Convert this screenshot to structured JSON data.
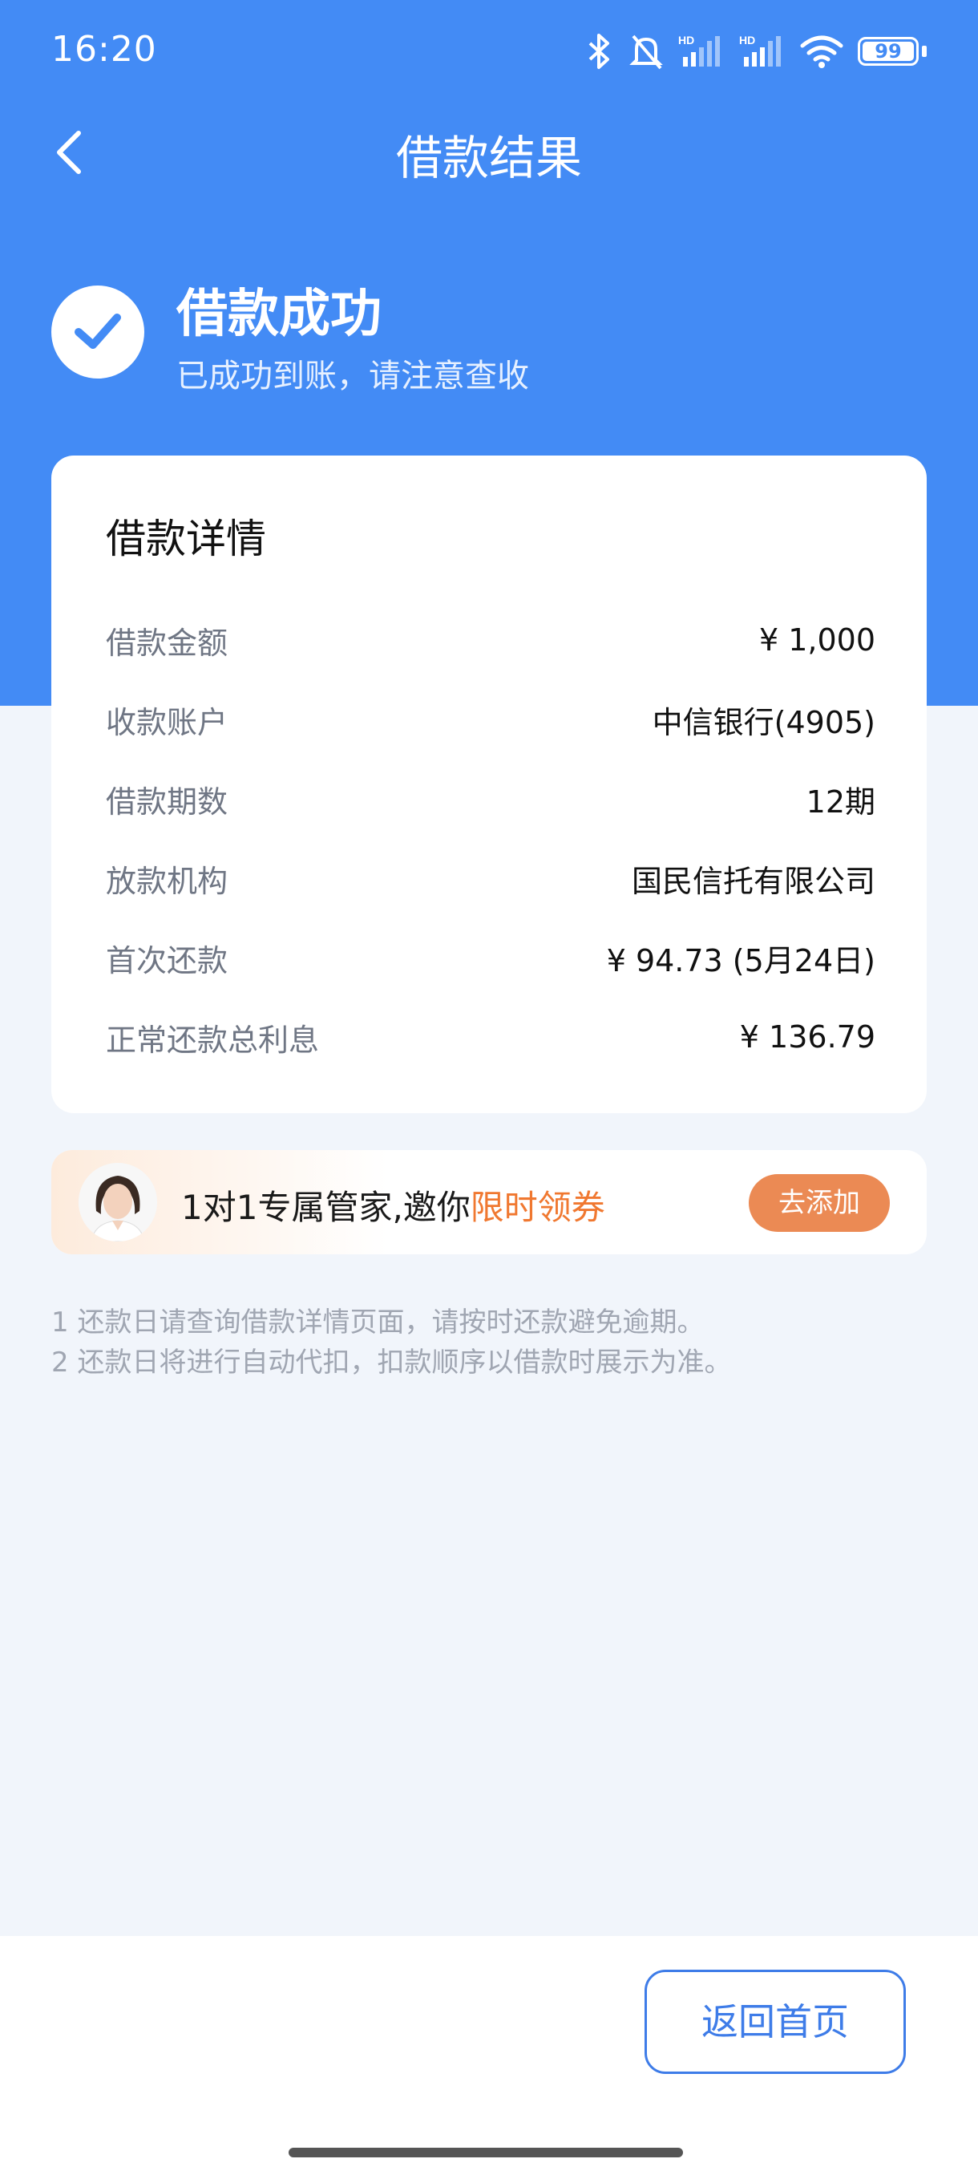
{
  "status_bar": {
    "time": "16:20",
    "battery": "99"
  },
  "header": {
    "title": "借款结果"
  },
  "result": {
    "title": "借款成功",
    "subtitle": "已成功到账，请注意查收"
  },
  "details": {
    "title": "借款详情",
    "rows": [
      {
        "label": "借款金额",
        "value": "¥ 1,000"
      },
      {
        "label": "收款账户",
        "value": "中信银行(4905)"
      },
      {
        "label": "借款期数",
        "value": "12期"
      },
      {
        "label": "放款机构",
        "value": "国民信托有限公司"
      },
      {
        "label": "首次还款",
        "value": "¥ 94.73 (5月24日)"
      },
      {
        "label": "正常还款总利息",
        "value": "¥ 136.79"
      }
    ]
  },
  "promo": {
    "text": "1对1专属管家,邀你",
    "highlight": "限时领券",
    "button": "去添加"
  },
  "notes": [
    "1 还款日请查询借款详情页面，请按时还款避免逾期。",
    "2 还款日将进行自动代扣，扣款顺序以借款时展示为准。"
  ],
  "footer": {
    "home_button": "返回首页"
  },
  "colors": {
    "primary": "#438BF5",
    "accent": "#F07830",
    "button_orange": "#EB8A54"
  }
}
